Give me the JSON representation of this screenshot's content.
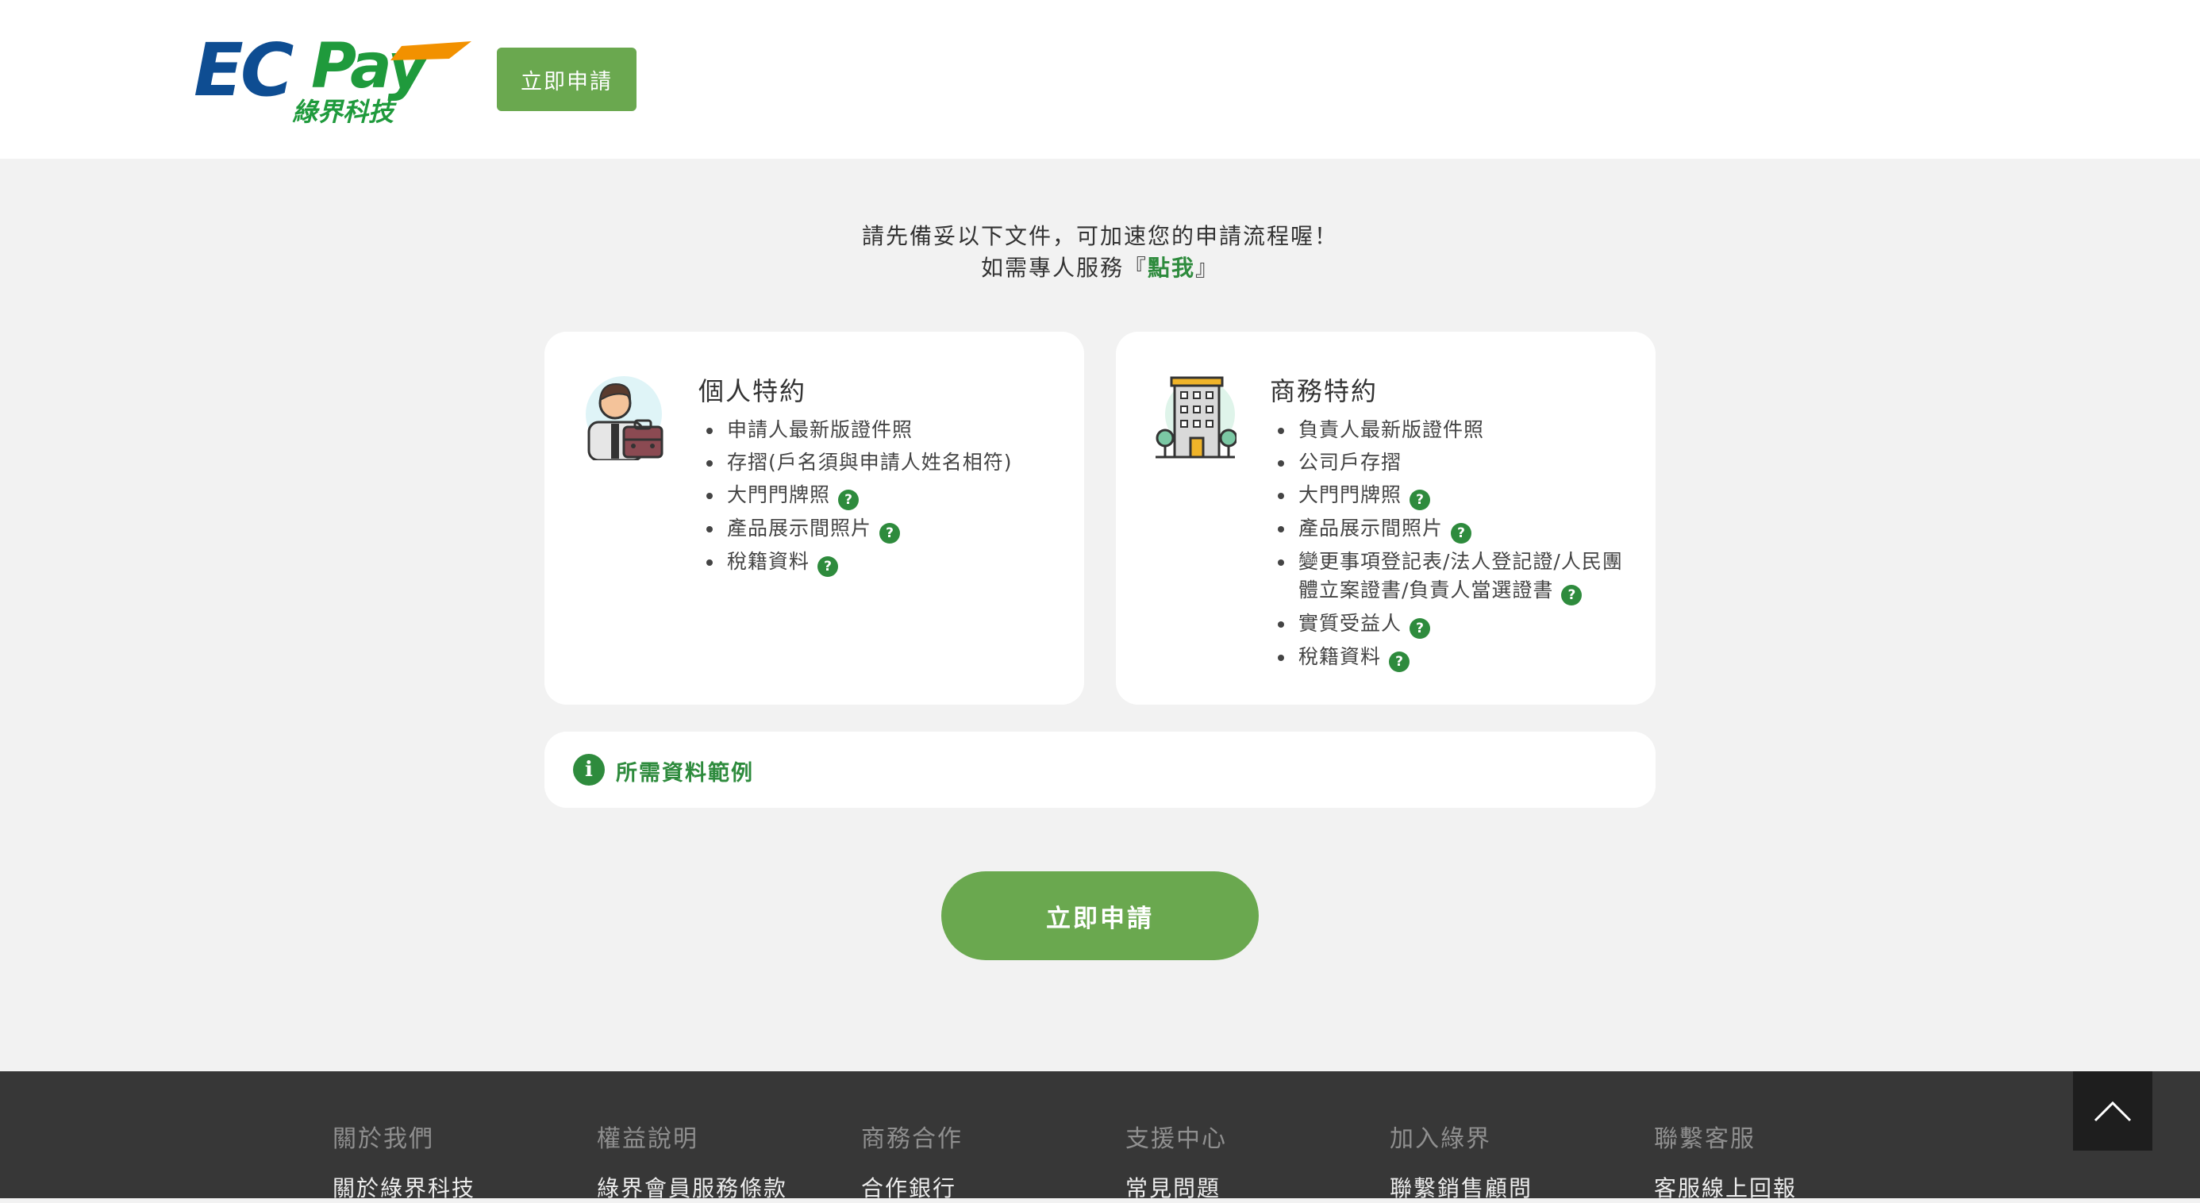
{
  "header": {
    "logo_text": "ECPay",
    "logo_subtext": "綠界科技",
    "apply_label": "立即申請"
  },
  "intro": {
    "line1": "請先備妥以下文件，可加速您的申請流程喔！",
    "line2_prefix": "如需專人服務『",
    "line2_link": "點我",
    "line2_suffix": "』"
  },
  "personal": {
    "title": "個人特約",
    "icon": "businessman-icon",
    "items": [
      {
        "label": "申請人最新版證件照",
        "help": false
      },
      {
        "label": "存摺(戶名須與申請人姓名相符)",
        "help": false
      },
      {
        "label": "大門門牌照",
        "help": true
      },
      {
        "label": "產品展示間照片",
        "help": true
      },
      {
        "label": "稅籍資料",
        "help": true
      }
    ]
  },
  "business": {
    "title": "商務特約",
    "icon": "office-building-icon",
    "items": [
      {
        "label": "負責人最新版證件照",
        "help": false
      },
      {
        "label": "公司戶存摺",
        "help": false
      },
      {
        "label": "大門門牌照",
        "help": true
      },
      {
        "label": "產品展示間照片",
        "help": true
      },
      {
        "label": "變更事項登記表/法人登記證/人民團體立案證書/負責人當選證書",
        "help": true
      },
      {
        "label": "實質受益人",
        "help": true
      },
      {
        "label": "稅籍資料",
        "help": true
      }
    ]
  },
  "help_symbol": "?",
  "examples": {
    "info_symbol": "i",
    "label": "所需資料範例"
  },
  "main_apply_label": "立即申請",
  "footer": {
    "columns": [
      {
        "heading": "關於我們",
        "link": "關於綠界科技"
      },
      {
        "heading": "權益說明",
        "link": "綠界會員服務條款"
      },
      {
        "heading": "商務合作",
        "link": "合作銀行"
      },
      {
        "heading": "支援中心",
        "link": "常見問題"
      },
      {
        "heading": "加入綠界",
        "link": "聯繫銷售顧問"
      },
      {
        "heading": "聯繫客服",
        "link": "客服線上回報"
      }
    ]
  },
  "colors": {
    "brand_green": "#6aa84f",
    "accent_green": "#2e8b3d",
    "logo_blue": "#0e4d92",
    "logo_orange": "#f29100",
    "footer_bg": "#373737"
  }
}
